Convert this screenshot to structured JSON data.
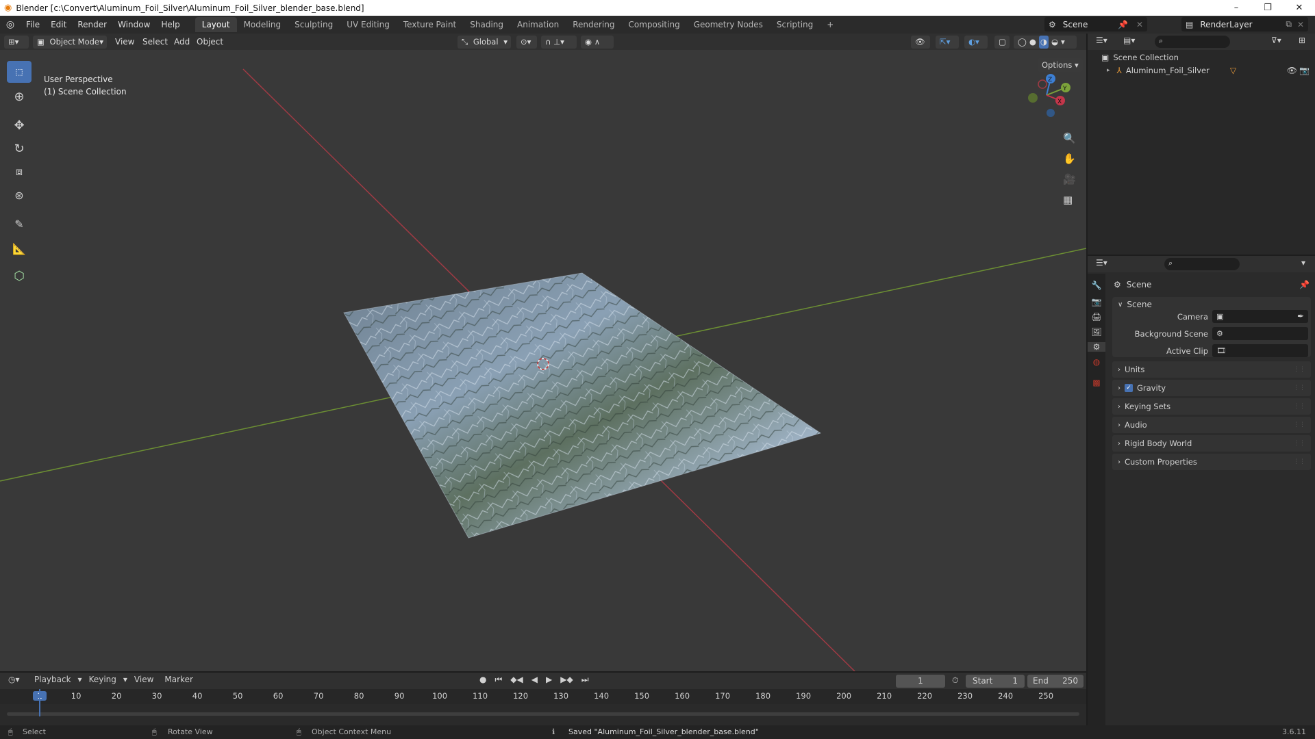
{
  "window": {
    "title": "Blender [c:\\Convert\\Aluminum_Foil_Silver\\Aluminum_Foil_Silver_blender_base.blend]",
    "minimize": "–",
    "maximize": "❐",
    "close": "✕"
  },
  "menu": [
    "File",
    "Edit",
    "Render",
    "Window",
    "Help"
  ],
  "workspaces": [
    "Layout",
    "Modeling",
    "Sculpting",
    "UV Editing",
    "Texture Paint",
    "Shading",
    "Animation",
    "Rendering",
    "Compositing",
    "Geometry Nodes",
    "Scripting",
    "+"
  ],
  "active_workspace": "Layout",
  "scene_selector": {
    "label": "Scene"
  },
  "render_layer": {
    "label": "RenderLayer"
  },
  "viewport_header": {
    "mode": "Object Mode",
    "menus": [
      "View",
      "Select",
      "Add",
      "Object"
    ],
    "transform_orientation": "Global",
    "options_label": "Options"
  },
  "viewport": {
    "perspective_label": "User Perspective",
    "collection_label": "(1) Scene Collection",
    "gizmo": {
      "z": "Z",
      "y": "Y",
      "x": "X"
    }
  },
  "outliner": {
    "root": "Scene Collection",
    "items": [
      {
        "label": "Aluminum_Foil_Silver"
      }
    ]
  },
  "properties": {
    "context_title": "Scene",
    "panel_title": "Scene",
    "fields": [
      {
        "label": "Camera"
      },
      {
        "label": "Background Scene"
      },
      {
        "label": "Active Clip"
      }
    ],
    "subpanels": [
      "Units",
      "Gravity",
      "Keying Sets",
      "Audio",
      "Rigid Body World",
      "Custom Properties"
    ],
    "gravity_checked": true
  },
  "timeline": {
    "menus": [
      "Playback",
      "Keying",
      "View",
      "Marker"
    ],
    "current_frame": "1",
    "start_label": "Start",
    "start_value": "1",
    "end_label": "End",
    "end_value": "250",
    "ticks": [
      "1",
      "10",
      "20",
      "30",
      "40",
      "50",
      "60",
      "70",
      "80",
      "90",
      "100",
      "110",
      "120",
      "130",
      "140",
      "150",
      "160",
      "170",
      "180",
      "190",
      "200",
      "210",
      "220",
      "230",
      "240",
      "250"
    ]
  },
  "statusbar": {
    "select": "Select",
    "rotate": "Rotate View",
    "context_menu": "Object Context Menu",
    "message": "Saved \"Aluminum_Foil_Silver_blender_base.blend\"",
    "version": "3.6.11"
  },
  "colors": {
    "accent": "#4772b3",
    "x_axis": "#c4364a",
    "y_axis": "#7ca23a",
    "z_axis": "#3d7fd3"
  }
}
